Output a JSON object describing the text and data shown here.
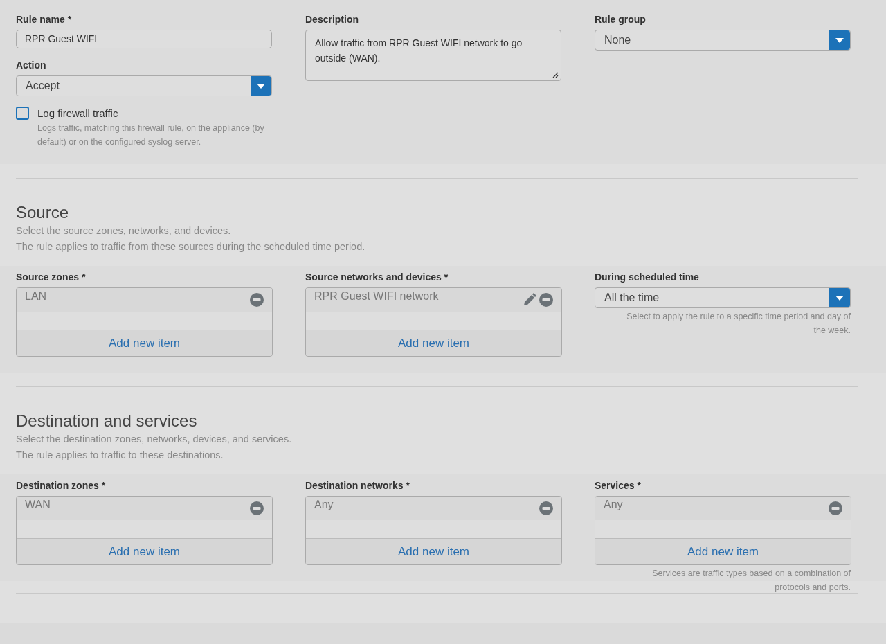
{
  "general": {
    "rule_name": {
      "label": "Rule name *",
      "value": "RPR Guest WIFI"
    },
    "action": {
      "label": "Action",
      "value": "Accept"
    },
    "log": {
      "label": "Log firewall traffic",
      "checked": false,
      "hint": "Logs traffic, matching this firewall rule, on the appliance (by default) or on the configured syslog server."
    },
    "description": {
      "label": "Description",
      "value": "Allow traffic from RPR Guest WIFI network to go outside (WAN)."
    },
    "rule_group": {
      "label": "Rule group",
      "value": "None"
    }
  },
  "sections": [
    {
      "title": "Source",
      "lines": [
        "Select the source zones, networks, and devices.",
        "The rule applies to traffic from these sources during the scheduled time period."
      ],
      "fields": [
        {
          "kind": "list",
          "label": "Source zones *",
          "items": [
            {
              "text": "LAN",
              "editable": false
            }
          ],
          "add_label": "Add new item"
        },
        {
          "kind": "list",
          "label": "Source networks and devices *",
          "items": [
            {
              "text": "RPR Guest WIFI network",
              "editable": true
            }
          ],
          "add_label": "Add new item"
        },
        {
          "kind": "select",
          "label": "During scheduled time",
          "value": "All the time",
          "hint": "Select to apply the rule to a specific time period and day of the week."
        }
      ]
    },
    {
      "title": "Destination and services",
      "lines": [
        "Select the destination zones, networks, devices, and services.",
        "The rule applies to traffic to these destinations."
      ],
      "fields": [
        {
          "kind": "list",
          "label": "Destination zones *",
          "items": [
            {
              "text": "WAN",
              "editable": false
            }
          ],
          "add_label": "Add new item"
        },
        {
          "kind": "list",
          "label": "Destination networks *",
          "items": [
            {
              "text": "Any",
              "editable": false
            }
          ],
          "add_label": "Add new item"
        },
        {
          "kind": "list",
          "label": "Services *",
          "items": [
            {
              "text": "Any",
              "editable": false
            }
          ],
          "add_label": "Add new item",
          "hint": "Services are traffic types based on a combination of protocols and ports."
        }
      ]
    }
  ]
}
